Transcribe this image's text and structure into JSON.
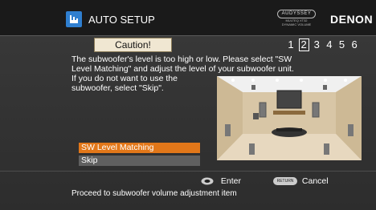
{
  "header": {
    "title": "AUTO SETUP",
    "audyssey_logo": "AUDYSSEY",
    "audyssey_sub_1": "MULTEQ XT32",
    "audyssey_sub_2": "DYNAMIC VOLUME",
    "brand": "DENON",
    "icon": "setup-wizard-icon"
  },
  "caution": {
    "label": "Caution!"
  },
  "steps": {
    "items": [
      "1",
      "2",
      "3",
      "4",
      "5",
      "6"
    ],
    "current": "2"
  },
  "message": {
    "line1": "The subwoofer's level is too high or low. Please select \"SW",
    "line2": "Level Matching\" and adjust the level of your subwoofer unit.",
    "line3": "If you do not want to use the",
    "line4": "subwoofer, select \"Skip\"."
  },
  "options": [
    {
      "label": "SW Level Matching",
      "selected": true
    },
    {
      "label": "Skip",
      "selected": false
    }
  ],
  "footer": {
    "enter_label": "Enter",
    "return_badge": "RETURN",
    "cancel_label": "Cancel",
    "hint": "Proceed to subwoofer volume adjustment item"
  },
  "colors": {
    "selected_option": "#e27719",
    "unselected_option": "#606060",
    "accent_icon": "#2f7fd0"
  }
}
